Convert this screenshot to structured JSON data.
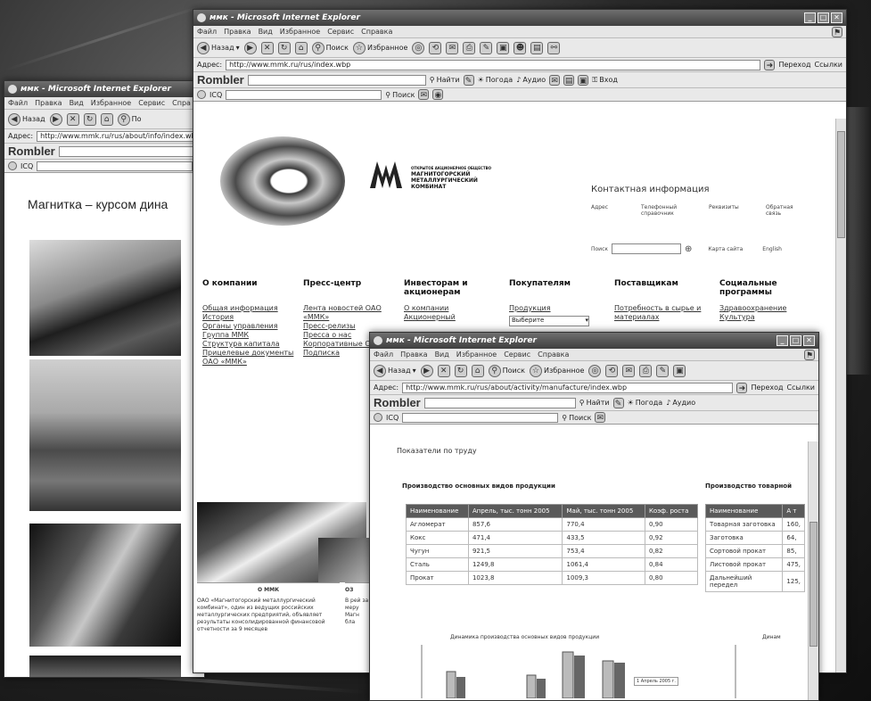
{
  "windows": {
    "left": {
      "title": "ммк - Microsoft Internet Explorer",
      "menu": [
        "Файл",
        "Правка",
        "Вид",
        "Избранное",
        "Сервис",
        "Спра"
      ],
      "toolbar": {
        "back_label": "Назад",
        "search_label": "По"
      },
      "address": {
        "label": "Адрес:",
        "url": "http://www.mmk.ru/rus/about/info/index.wbp"
      },
      "rambler_logo": "Rombler",
      "icq_label": "ICQ",
      "heading": "Магнитка – курсом дина"
    },
    "middle": {
      "title": "ммк - Microsoft Internet Explorer",
      "menu": [
        "Файл",
        "Правка",
        "Вид",
        "Избранное",
        "Сервис",
        "Справка"
      ],
      "toolbar": {
        "back_label": "Назад",
        "search_label": "Поиск",
        "favorites_label": "Избранное"
      },
      "address": {
        "label": "Адрес:",
        "url": "http://www.mmk.ru/rus/index.wbp",
        "go_label": "Переход",
        "links_label": "Ссылки"
      },
      "rambler_logo": "Rombler",
      "rambler_search": "Найти",
      "rambler_items": [
        "Погода",
        "Аудио",
        "Вход"
      ],
      "icq_label": "ICQ",
      "icq_search": "Поиск",
      "company_lines": [
        "ОТКРЫТОЕ АКЦИОНЕРНОЕ ОБЩЕСТВО",
        "МАГНИТОГОРСКИЙ",
        "МЕТАЛЛУРГИЧЕСКИЙ",
        "КОМБИНАТ"
      ],
      "contacts": {
        "title": "Контактная информация",
        "items": [
          "Адрес",
          "Телефонный справочник",
          "Реквизиты",
          "Обратная связь"
        ],
        "search_label": "Поиск",
        "sitemap_label": "Карта сайта",
        "english_label": "English"
      },
      "nav": [
        {
          "title": "О компании",
          "links": [
            "Общая информация",
            "История",
            "Органы управления",
            "Группа ММК",
            "Структура капитала",
            "Прицелевые документы ОАО «ММК»"
          ]
        },
        {
          "title": "Пресс-центр",
          "links": [
            "Лента новостей ОАО «ММК»",
            "Пресс-релизы",
            "Пресса о нас",
            "Корпоративные СМИ",
            "Подписка"
          ]
        },
        {
          "title": "Инвесторам и акционерам",
          "links": [
            "О компании",
            "Акционерный"
          ]
        },
        {
          "title": "Покупателям",
          "links": [
            "Продукция"
          ],
          "select_value": "Выберите"
        },
        {
          "title": "Поставщикам",
          "links": [
            "Потребность в сырье и материалах"
          ]
        },
        {
          "title": "Социальные программы",
          "links": [
            "Здравоохранение",
            "Культура"
          ]
        }
      ],
      "bottom": {
        "heading1": "О ММК",
        "text1": "ОАО «Магнитогорский металлургический комбинат», один из ведущих российских металлургических предприятий, объявляет результаты консолидированной финансовой отчетности за 9 месяцев",
        "heading2": "ОЗ",
        "text2": "В рей за меру Магн бла"
      }
    },
    "front": {
      "title": "ммк - Microsoft Internet Explorer",
      "menu": [
        "Файл",
        "Правка",
        "Вид",
        "Избранное",
        "Сервис",
        "Справка"
      ],
      "toolbar": {
        "back_label": "Назад",
        "search_label": "Поиск",
        "favorites_label": "Избранное"
      },
      "address": {
        "label": "Адрес:",
        "url": "http://www.mmk.ru/rus/about/activity/manufacture/index.wbp",
        "go_label": "Переход",
        "links_label": "Ссылки"
      },
      "rambler_logo": "Rombler",
      "rambler_search": "Найти",
      "rambler_items": [
        "Погода",
        "Аудио"
      ],
      "icq_label": "ICQ",
      "icq_search": "Поиск",
      "section_title": "Показатели по труду",
      "table1": {
        "title": "Производство основных видов продукции",
        "headers": [
          "Наименование",
          "Апрель, тыс. тонн 2005",
          "Май, тыс. тонн 2005",
          "Коэф. роста"
        ],
        "rows": [
          [
            "Агломерат",
            "857,6",
            "770,4",
            "0,90"
          ],
          [
            "Кокс",
            "471,4",
            "433,5",
            "0,92"
          ],
          [
            "Чугун",
            "921,5",
            "753,4",
            "0,82"
          ],
          [
            "Сталь",
            "1249,8",
            "1061,4",
            "0,84"
          ],
          [
            "Прокат",
            " 1023,8",
            "1009,3",
            "0,80"
          ]
        ]
      },
      "table2": {
        "title": "Производство товарной",
        "headers": [
          "Наименование",
          "А т"
        ],
        "rows": [
          [
            "Товарная заготовка",
            "160,"
          ],
          [
            "Заготовка",
            "64,"
          ],
          [
            "Сортовой прокат",
            "85,"
          ],
          [
            "Листовой прокат",
            "475,"
          ],
          [
            "Дальнейший передел",
            "125,"
          ]
        ]
      },
      "chart1_title": "Динамика производства основных видов продукции",
      "chart2_title": "Динам",
      "legend_item": "1 Апрель 2005 г."
    }
  }
}
